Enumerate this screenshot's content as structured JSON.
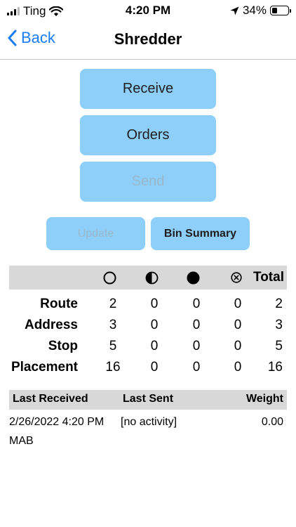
{
  "status_bar": {
    "carrier": "Ting",
    "time": "4:20 PM",
    "battery": "34%",
    "battery_level": 0.34,
    "icons": [
      "signal-icon",
      "wifi-icon",
      "location-arrow-icon",
      "battery-icon"
    ]
  },
  "nav": {
    "back_label": "Back",
    "title": "Shredder"
  },
  "actions": {
    "receive": "Receive",
    "orders": "Orders",
    "send": "Send",
    "update": "Update",
    "bin_summary": "Bin Summary"
  },
  "counts": {
    "columns": {
      "empty_icon": "empty-circle-icon",
      "half_icon": "half-filled-circle-icon",
      "full_icon": "filled-circle-icon",
      "cancel_icon": "circled-x-icon",
      "total": "Total"
    },
    "rows": [
      {
        "label": "Route",
        "empty": "2",
        "half": "0",
        "full": "0",
        "cancelled": "0",
        "total": "2"
      },
      {
        "label": "Address",
        "empty": "3",
        "half": "0",
        "full": "0",
        "cancelled": "0",
        "total": "3"
      },
      {
        "label": "Stop",
        "empty": "5",
        "half": "0",
        "full": "0",
        "cancelled": "0",
        "total": "5"
      },
      {
        "label": "Placement",
        "empty": "16",
        "half": "0",
        "full": "0",
        "cancelled": "0",
        "total": "16"
      }
    ]
  },
  "activity": {
    "headers": {
      "last_received": "Last Received",
      "last_sent": "Last Sent",
      "weight": "Weight"
    },
    "last_received": "2/26/2022 4:20 PM",
    "last_received_by": "MAB",
    "last_sent": "[no activity]",
    "weight": "0.00"
  },
  "colors": {
    "accent": "#1a7cf5",
    "button": "#8ecffa",
    "header_bg": "#d8d8d8"
  }
}
